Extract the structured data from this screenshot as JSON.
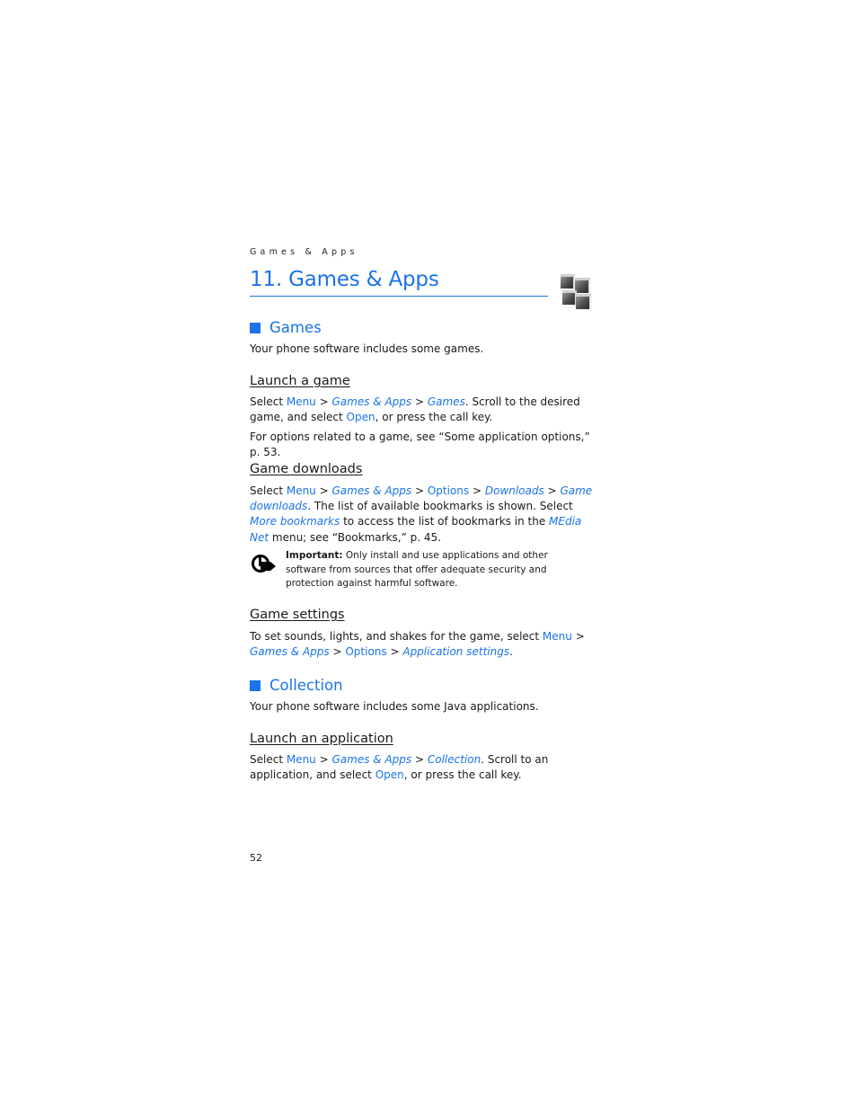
{
  "running_head": "Games & Apps",
  "chapter": {
    "title": "11. Games & Apps",
    "icon": "games-apps-cubes-icon"
  },
  "games": {
    "heading": "Games",
    "intro": "Your phone software includes some games.",
    "launch": {
      "heading": "Launch a game",
      "p1": {
        "t0": "Select ",
        "menu": "Menu",
        "sep1": " > ",
        "games_apps": "Games & Apps",
        "sep2": " > ",
        "games": "Games",
        "t1": ". Scroll to the desired game, and select ",
        "open": "Open",
        "t2": ", or press the call key."
      },
      "p2": "For options related to a game, see “Some application options,” p. 53."
    },
    "downloads": {
      "heading": "Game downloads",
      "p1": {
        "t0": "Select ",
        "menu": "Menu",
        "sep1": " > ",
        "games_apps": "Games & Apps",
        "sep2": " > ",
        "options": "Options",
        "sep3": " > ",
        "downloads": "Downloads",
        "sep4": " > ",
        "game_downloads": "Game downloads",
        "t1": ". The list of available bookmarks is shown. Select ",
        "more_bookmarks": "More bookmarks",
        "t2": " to access the list of bookmarks in the ",
        "media_net": "MEdia Net",
        "t3": " menu; see “Bookmarks,” p. 45."
      },
      "note": {
        "icon": "important-hand-icon",
        "label": "Important:",
        "text": " Only install and use applications and other software from sources that offer adequate security and protection against harmful software."
      }
    },
    "settings": {
      "heading": "Game settings",
      "p1": {
        "t0": "To set sounds, lights, and shakes for the game, select ",
        "menu": "Menu",
        "sep1": " > ",
        "games_apps": "Games & Apps",
        "sep2": " > ",
        "options": "Options",
        "sep3": " > ",
        "app_settings": "Application settings",
        "t1": "."
      }
    }
  },
  "collection": {
    "heading": "Collection",
    "intro": "Your phone software includes some Java applications.",
    "launch": {
      "heading": "Launch an application",
      "p1": {
        "t0": "Select ",
        "menu": "Menu",
        "sep1": " > ",
        "games_apps": "Games & Apps",
        "sep2": " > ",
        "collection": "Collection",
        "t1": ". Scroll to an application, and select ",
        "open": "Open",
        "t2": ", or press the call key."
      }
    }
  },
  "page_number": "52",
  "colors": {
    "accent": "#1a73e8",
    "text": "#1a1a1a"
  }
}
